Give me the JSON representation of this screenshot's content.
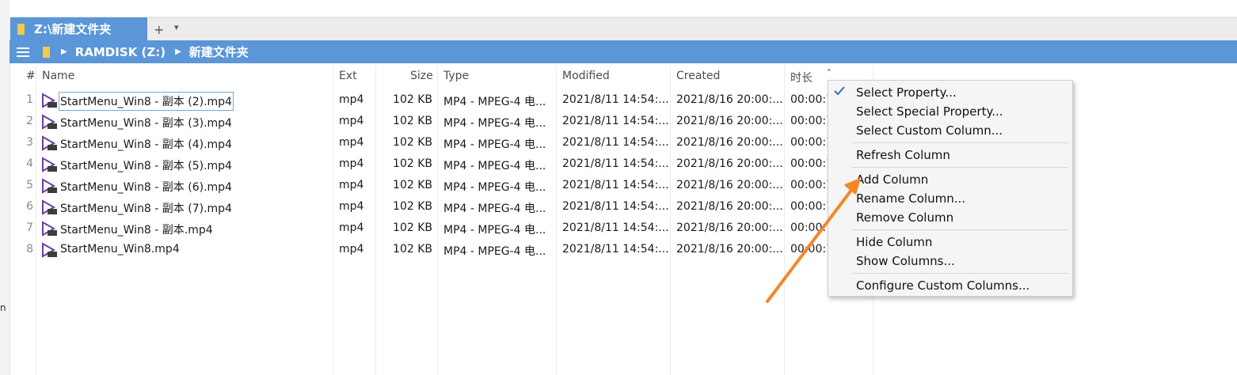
{
  "tab": {
    "title": "Z:\\新建文件夹",
    "new_tab": "+",
    "tab_list": "▾"
  },
  "address": {
    "drive": "RAMDISK (Z:)",
    "folder": "新建文件夹"
  },
  "columns": {
    "num": "#",
    "name": "Name",
    "ext": "Ext",
    "size": "Size",
    "type": "Type",
    "modified": "Modified",
    "created": "Created",
    "duration": "时长",
    "sort": "˄"
  },
  "rows": [
    {
      "num": "1",
      "name": "StartMenu_Win8 - 副本 (2).mp4",
      "ext": "mp4",
      "size": "102 KB",
      "type": "MP4 - MPEG-4 电...",
      "modified": "2021/8/11 14:54:...",
      "created": "2021/8/16 20:00:...",
      "duration": "00:00:1"
    },
    {
      "num": "2",
      "name": "StartMenu_Win8 - 副本 (3).mp4",
      "ext": "mp4",
      "size": "102 KB",
      "type": "MP4 - MPEG-4 电...",
      "modified": "2021/8/11 14:54:...",
      "created": "2021/8/16 20:00:...",
      "duration": "00:00:1"
    },
    {
      "num": "3",
      "name": "StartMenu_Win8 - 副本 (4).mp4",
      "ext": "mp4",
      "size": "102 KB",
      "type": "MP4 - MPEG-4 电...",
      "modified": "2021/8/11 14:54:...",
      "created": "2021/8/16 20:00:...",
      "duration": "00:00:1"
    },
    {
      "num": "4",
      "name": "StartMenu_Win8 - 副本 (5).mp4",
      "ext": "mp4",
      "size": "102 KB",
      "type": "MP4 - MPEG-4 电...",
      "modified": "2021/8/11 14:54:...",
      "created": "2021/8/16 20:00:...",
      "duration": "00:00:1"
    },
    {
      "num": "5",
      "name": "StartMenu_Win8 - 副本 (6).mp4",
      "ext": "mp4",
      "size": "102 KB",
      "type": "MP4 - MPEG-4 电...",
      "modified": "2021/8/11 14:54:...",
      "created": "2021/8/16 20:00:...",
      "duration": "00:00:1"
    },
    {
      "num": "6",
      "name": "StartMenu_Win8 - 副本 (7).mp4",
      "ext": "mp4",
      "size": "102 KB",
      "type": "MP4 - MPEG-4 电...",
      "modified": "2021/8/11 14:54:...",
      "created": "2021/8/16 20:00:...",
      "duration": "00:00:1"
    },
    {
      "num": "7",
      "name": "StartMenu_Win8 - 副本.mp4",
      "ext": "mp4",
      "size": "102 KB",
      "type": "MP4 - MPEG-4 电...",
      "modified": "2021/8/11 14:54:...",
      "created": "2021/8/16 20:00:...",
      "duration": "00:00:"
    },
    {
      "num": "8",
      "name": "StartMenu_Win8.mp4",
      "ext": "mp4",
      "size": "102 KB",
      "type": "MP4 - MPEG-4 电...",
      "modified": "2021/8/11 14:54:...",
      "created": "2021/8/16 20:00:...",
      "duration": "00:00:1"
    }
  ],
  "context_menu": {
    "select_property": "Select Property...",
    "select_special_property": "Select Special Property...",
    "select_custom_column": "Select Custom Column...",
    "refresh_column": "Refresh Column",
    "add_column": "Add Column",
    "rename_column": "Rename Column...",
    "remove_column": "Remove Column",
    "hide_column": "Hide Column",
    "show_columns": "Show Columns...",
    "configure_custom_columns": "Configure Custom Columns..."
  },
  "left_edge_text": "n",
  "colors": {
    "accent": "#5a96d8",
    "folder": "#f3c94a",
    "arrow": "#f5862a",
    "play_icon": "#6b3fa0"
  }
}
